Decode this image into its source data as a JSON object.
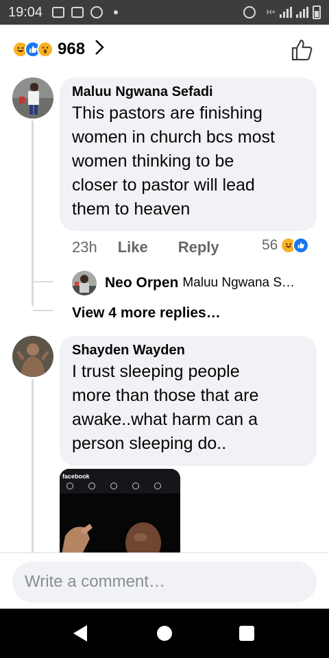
{
  "status_bar": {
    "time": "19:04",
    "network_label": "H+"
  },
  "reactions": {
    "count": "968",
    "icons": [
      "haha-icon",
      "like-icon",
      "wow-icon"
    ]
  },
  "comments": [
    {
      "author": "Maluu Ngwana Sefadi",
      "text_lines": [
        "This pastors are finishing",
        "women in church bcs most",
        "women thinking to be",
        "closer to pastor will lead",
        "them to heaven"
      ],
      "time": "23h",
      "like_label": "Like",
      "reply_label": "Reply",
      "reaction_count": "56",
      "reply": {
        "author": "Neo Orpen",
        "snippet": "Maluu Ngwana S…"
      },
      "more_replies": "View 4 more replies…"
    },
    {
      "author": "Shayden Wayden",
      "text_lines": [
        "I trust sleeping people",
        "more than those that are",
        "awake..what harm can a",
        "person sleeping do.."
      ],
      "attachment": {
        "app_label": "facebook"
      }
    }
  ],
  "composer": {
    "placeholder": "Write a comment…"
  },
  "colors": {
    "bubble": "#f0f2f5",
    "like_blue": "#1877f2",
    "haha_yellow": "#f7b125"
  }
}
